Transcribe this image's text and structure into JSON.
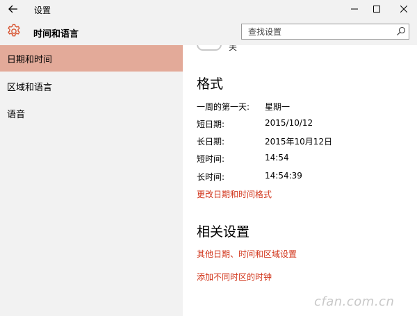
{
  "window": {
    "title": "设置",
    "back_icon": "back-arrow-icon",
    "minimize_icon": "minimize-icon",
    "maximize_icon": "maximize-icon",
    "close_icon": "close-icon"
  },
  "header": {
    "icon": "gear-icon",
    "title": "时间和语言",
    "search_placeholder": "查找设置",
    "search_icon": "search-icon"
  },
  "sidebar": {
    "items": [
      {
        "label": "日期和时间",
        "active": true
      },
      {
        "label": "区域和语言",
        "active": false
      },
      {
        "label": "语音",
        "active": false
      }
    ]
  },
  "main": {
    "toggle": {
      "label": "关",
      "state": "off"
    },
    "format": {
      "heading": "格式",
      "rows": [
        {
          "label": "一周的第一天:",
          "value": "星期一"
        },
        {
          "label": "短日期:",
          "value": "2015/10/12"
        },
        {
          "label": "长日期:",
          "value": "2015年10月12日"
        },
        {
          "label": "短时间:",
          "value": "14:54"
        },
        {
          "label": "长时间:",
          "value": "14:54:39"
        }
      ],
      "change_link": "更改日期和时间格式"
    },
    "related": {
      "heading": "相关设置",
      "links": [
        "其他日期、时间和区域设置",
        "添加不同时区的时钟"
      ]
    }
  },
  "watermark": "cfan.com.cn",
  "colors": {
    "accent": "#e3aa99",
    "link": "#d1341a",
    "gear": "#d8532f",
    "chrome": "#f2f2f2"
  }
}
